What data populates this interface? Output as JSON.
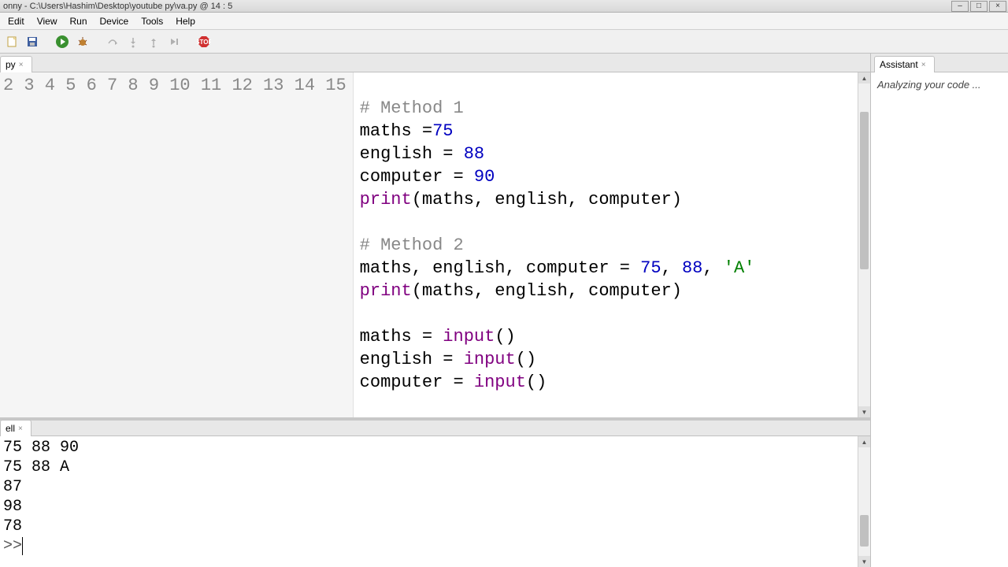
{
  "window": {
    "title": "onny  -  C:\\Users\\Hashim\\Desktop\\youtube py\\va.py  @  14 : 5"
  },
  "menus": [
    "Edit",
    "View",
    "Run",
    "Device",
    "Tools",
    "Help"
  ],
  "editor_tab": {
    "label": "py"
  },
  "shell_tab": {
    "label": "ell"
  },
  "assistant_tab": {
    "label": "Assistant"
  },
  "assistant_body": "Analyzing your code ...",
  "gutter_start": 2,
  "gutter_end": 15,
  "code_lines": [
    {
      "t": ""
    },
    {
      "t": "# Method 1",
      "cls": "comment"
    },
    {
      "parts": [
        {
          "t": "maths ="
        },
        {
          "t": "75",
          "cls": "num"
        }
      ]
    },
    {
      "parts": [
        {
          "t": "english = "
        },
        {
          "t": "88",
          "cls": "num"
        }
      ]
    },
    {
      "parts": [
        {
          "t": "computer = "
        },
        {
          "t": "90",
          "cls": "num"
        }
      ]
    },
    {
      "parts": [
        {
          "t": "print",
          "cls": "fn"
        },
        {
          "t": "(maths, english, computer)"
        }
      ]
    },
    {
      "t": ""
    },
    {
      "t": "# Method 2",
      "cls": "comment"
    },
    {
      "parts": [
        {
          "t": "maths, english, computer = "
        },
        {
          "t": "75",
          "cls": "num"
        },
        {
          "t": ", "
        },
        {
          "t": "88",
          "cls": "num"
        },
        {
          "t": ", "
        },
        {
          "t": "'A'",
          "cls": "str"
        }
      ]
    },
    {
      "parts": [
        {
          "t": "print",
          "cls": "fn"
        },
        {
          "t": "(maths, english, computer)"
        }
      ]
    },
    {
      "t": ""
    },
    {
      "parts": [
        {
          "t": "maths = "
        },
        {
          "t": "input",
          "cls": "fn"
        },
        {
          "t": "()"
        }
      ]
    },
    {
      "parts": [
        {
          "t": "english = "
        },
        {
          "t": "input",
          "cls": "fn"
        },
        {
          "t": "()"
        }
      ]
    },
    {
      "parts": [
        {
          "t": "computer = "
        },
        {
          "t": "input",
          "cls": "fn"
        },
        {
          "t": "()"
        }
      ]
    }
  ],
  "shell_output": [
    "75 88 90",
    "75 88 A",
    "87",
    "98",
    "78"
  ],
  "shell_prompt": ">>"
}
